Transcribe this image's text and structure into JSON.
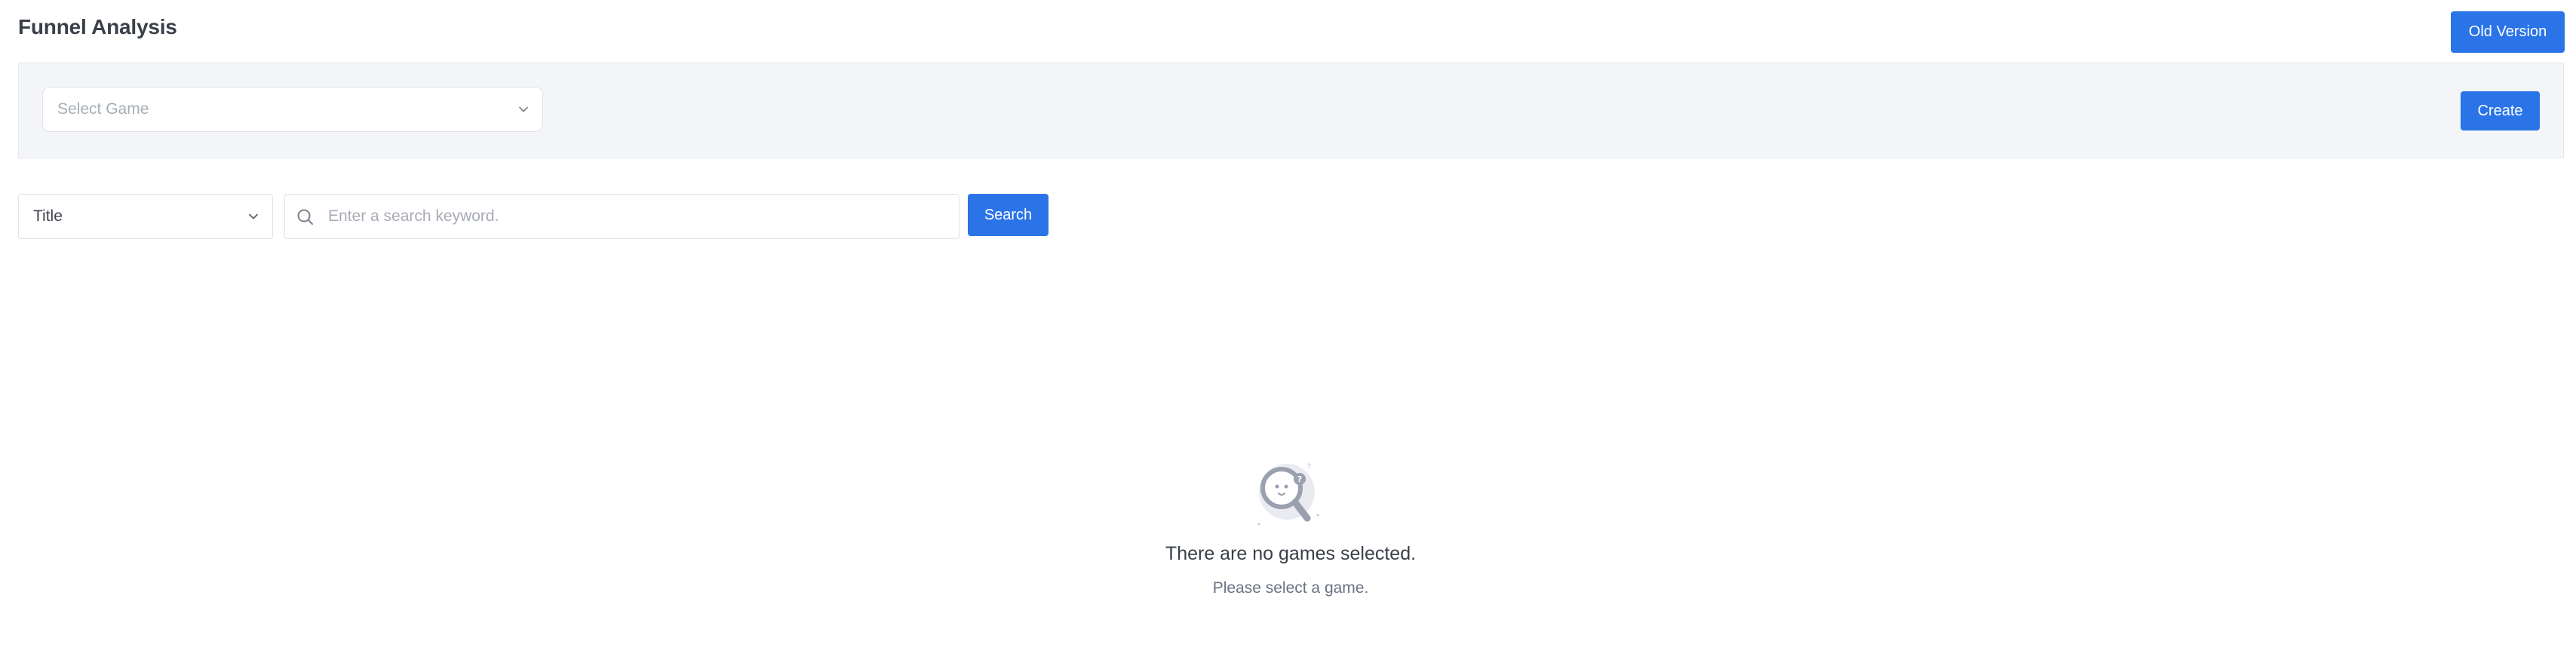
{
  "header": {
    "title": "Funnel Analysis",
    "old_version_label": "Old Version"
  },
  "filter_panel": {
    "game_select_placeholder": "Select Game",
    "create_label": "Create"
  },
  "search_bar": {
    "field_select_value": "Title",
    "keyword_placeholder": "Enter a search keyword.",
    "keyword_value": "",
    "search_label": "Search"
  },
  "empty_state": {
    "title": "There are no games selected.",
    "subtitle": "Please select a game."
  },
  "colors": {
    "primary": "#2b74e8",
    "panel_background": "#f4f5f8",
    "border": "#dfe2e8",
    "illustration": "#9aa0ae"
  },
  "icons": {
    "game_select": "chevron-down-icon",
    "title_select": "chevron-down-icon",
    "search": "search-icon",
    "empty_state": "magnifier-face-illustration"
  }
}
